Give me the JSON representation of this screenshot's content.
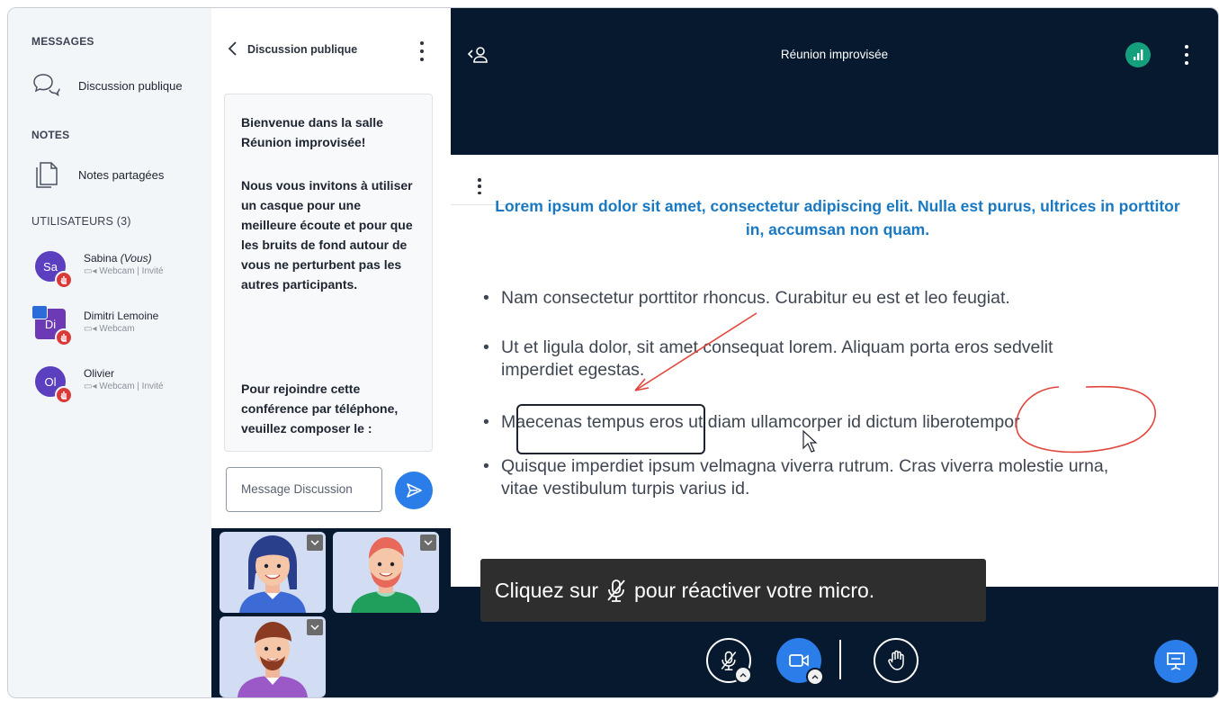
{
  "sidebar": {
    "messages_title": "MESSAGES",
    "public_chat": "Discussion publique",
    "notes_title": "NOTES",
    "shared_notes": "Notes partagées",
    "users_title": "UTILISATEURS (3)",
    "users": [
      {
        "initials": "Sa",
        "name": "Sabina",
        "you_tag": "(Vous)",
        "status": "Webcam | Invité",
        "color": "#5b3fbf"
      },
      {
        "initials": "Di",
        "name": "Dimitri Lemoine",
        "status": "Webcam",
        "color": "#6d3ab5"
      },
      {
        "initials": "Ol",
        "name": "Olivier",
        "status": "Webcam | Invité",
        "color": "#5b3fbf"
      }
    ]
  },
  "chat": {
    "title": "Discussion publique",
    "welcome_1a": "Bienvenue dans la salle",
    "welcome_1b": "Réunion improvisée!",
    "welcome_2": "Nous vous invitons à utiliser un casque pour une meilleure écoute et pour que les bruits de fond autour de vous ne perturbent pas les autres participants.",
    "welcome_3": "Pour rejoindre cette conférence par téléphone, veuillez composer le :",
    "input_placeholder": "Message Discussion"
  },
  "main": {
    "title": "Réunion improvisée",
    "slide": {
      "heading": "Lorem ipsum dolor sit amet, consectetur adipiscing elit. Nulla est purus, ultrices in porttitor in, accumsan non quam.",
      "bullets": [
        "Nam consectetur porttitor rhoncus. Curabitur eu est et leo feugiat.",
        "Ut et ligula dolor, sit amet consequat lorem. Aliquam porta eros sedvelit imperdiet egestas.",
        "Maecenas tempus eros ut diam ullamcorper id dictum liberotempor",
        "Quisque imperdiet ipsum velmagna viverra rutrum. Cras viverra molestie urna, vitae vestibulum turpis varius id."
      ]
    },
    "toast_before": "Cliquez sur",
    "toast_after": "pour réactiver votre micro."
  },
  "colors": {
    "accent": "#2b7de9",
    "dark_bg": "#07192e",
    "moderator": "#d93a3a",
    "connection": "#14a07c",
    "slide_heading": "#1978c2"
  },
  "icons": [
    "chat-bubbles-icon",
    "notes-document-icon",
    "chevron-left-icon",
    "kebab-menu-icon",
    "send-icon",
    "user-list-toggle-icon",
    "connection-status-icon",
    "muted-microphone-icon",
    "video-camera-icon",
    "raise-hand-icon",
    "presentation-icon",
    "chevron-down-icon"
  ]
}
